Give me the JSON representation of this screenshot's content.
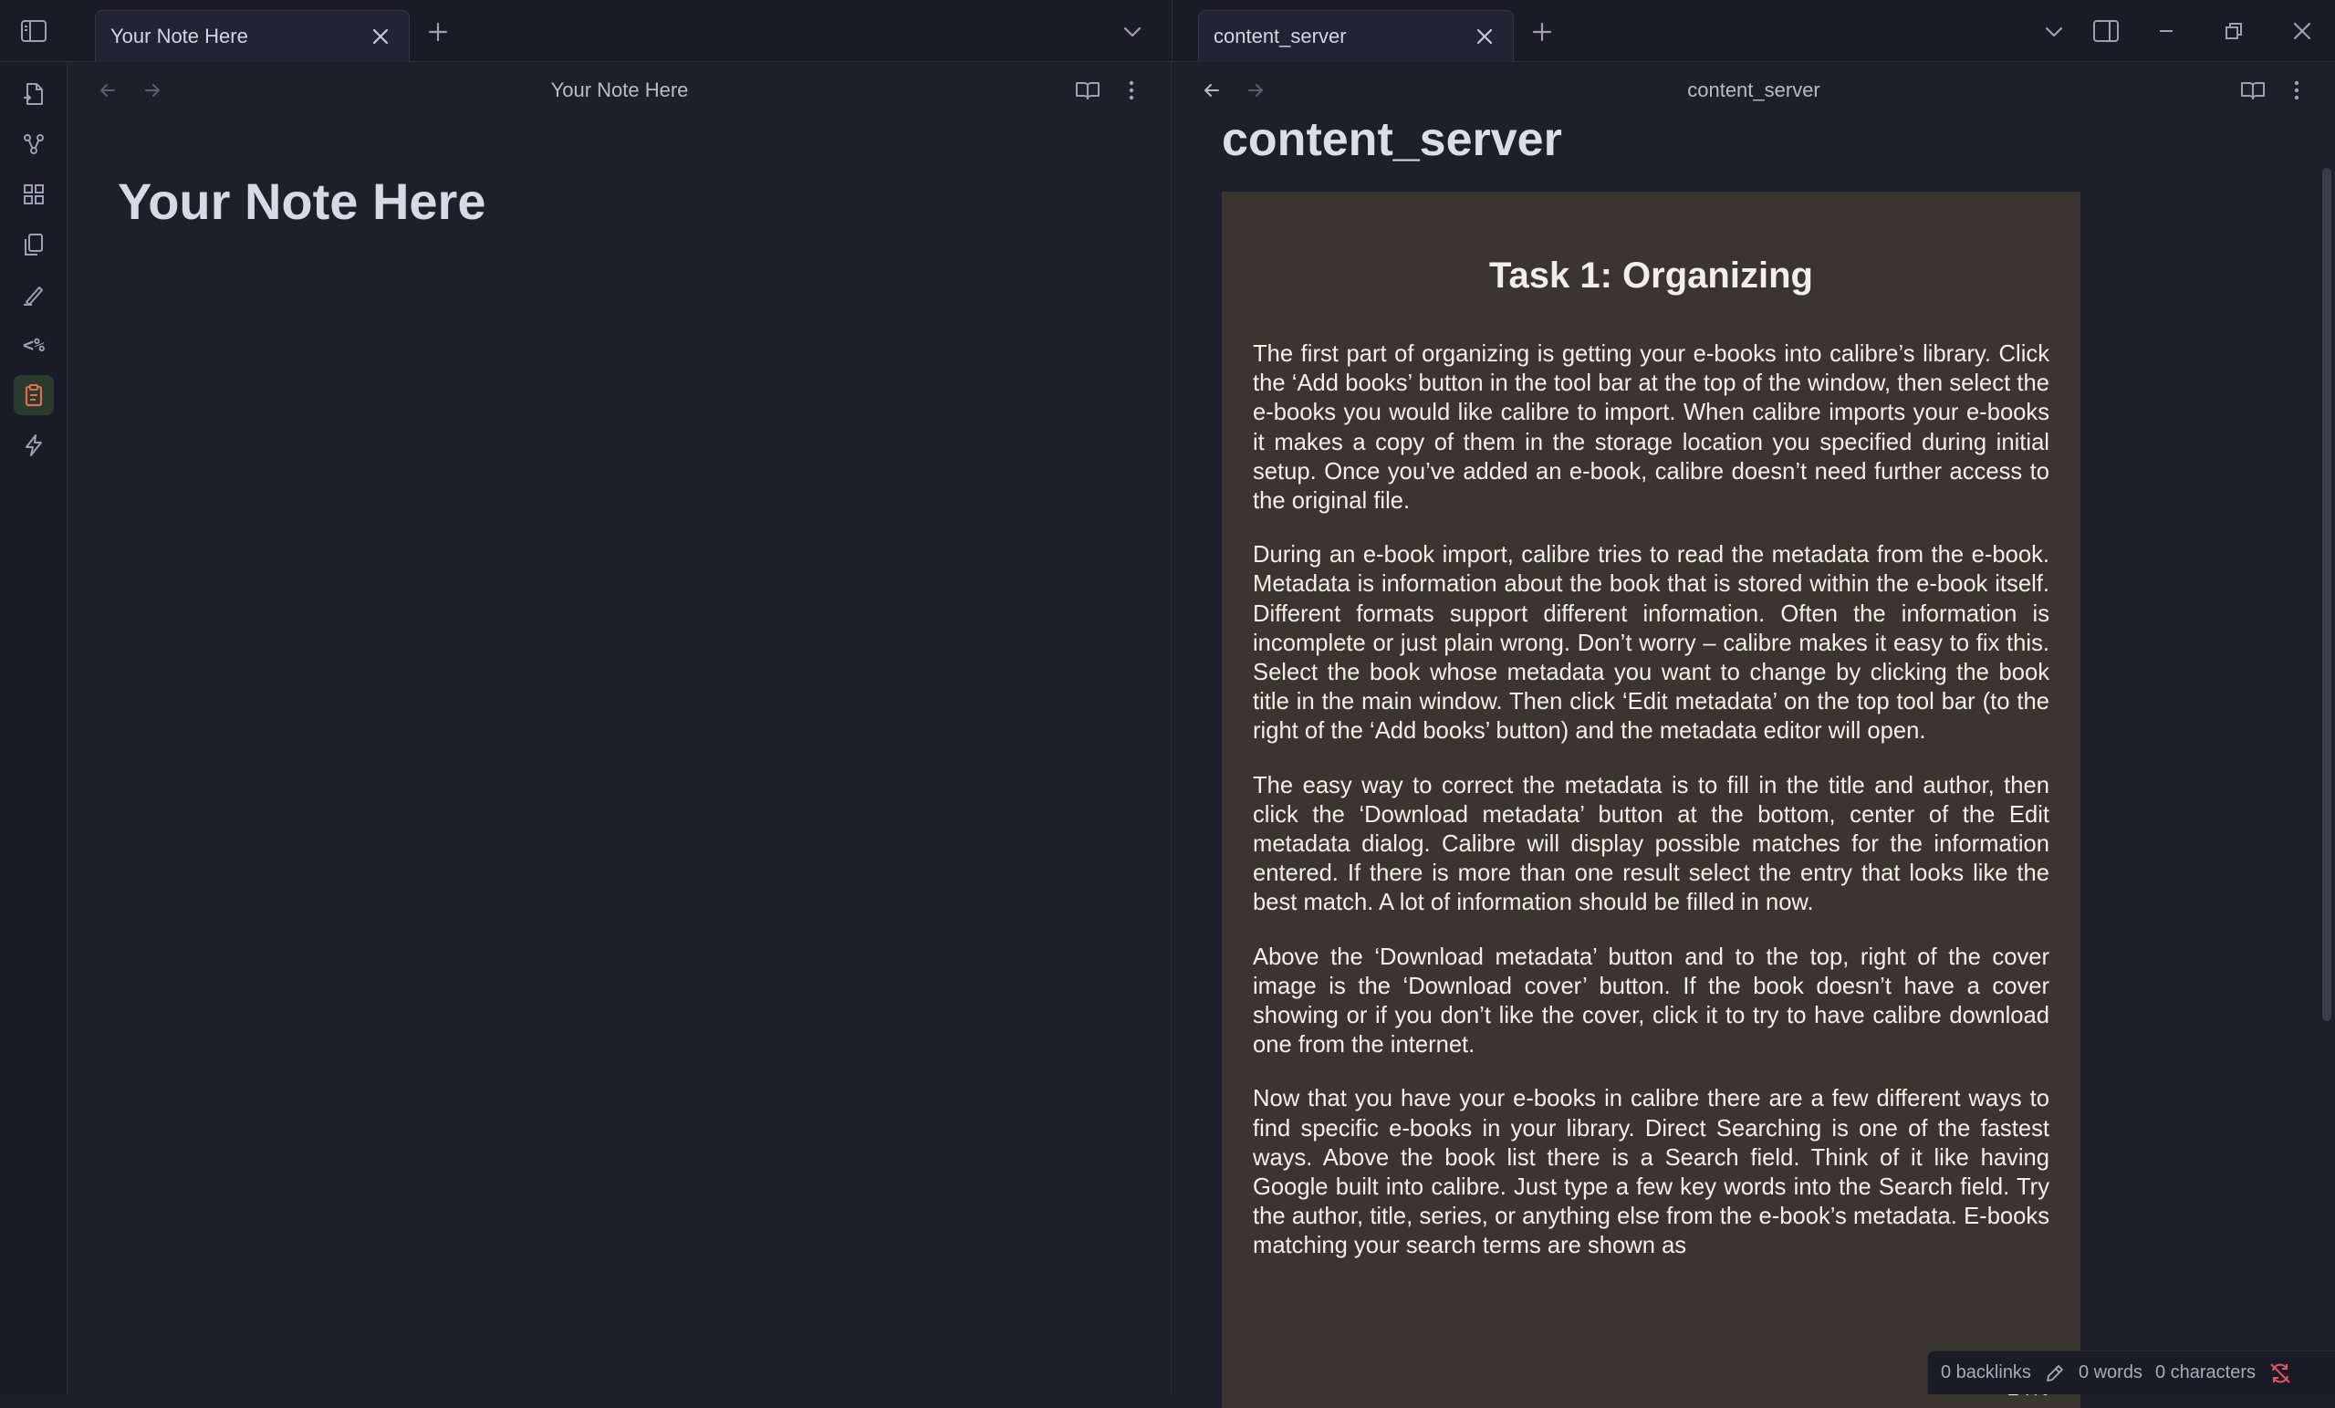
{
  "left_tab": {
    "title": "Your Note Here"
  },
  "right_tab": {
    "title": "content_server"
  },
  "left_view": {
    "header_title": "Your Note Here",
    "note_title": "Your Note Here"
  },
  "right_view": {
    "header_title": "content_server",
    "doc_title": "content_server",
    "pdf": {
      "heading": "Task 1: Organizing",
      "paragraphs": [
        "The first part of organizing is getting your e-books into calibre’s library. Click the ‘Add books’ button in the tool bar at the top of the window, then select the e-books you would like calibre to import. When calibre imports your e-books it makes a copy of them in the storage location you specified during initial setup. Once you’ve added an e-book, calibre doesn’t need further access to the original file.",
        "During an e-book import, calibre tries to read the metadata from the e-book. Metadata is information about the book that is stored within the e-book itself. Different formats support different information. Often the information is incomplete or just plain wrong. Don’t worry – calibre makes it easy to fix this. Select the book whose metadata you want to change by clicking the book title in the main window. Then click ‘Edit metadata’ on the top tool bar (to the right of the ‘Add books’ button) and the metadata editor will open.",
        "The easy way to correct the metadata is to fill in the title and author, then click the ‘Download metadata’ button at the bottom, center of the Edit metadata dialog. Calibre will display possible matches for the information entered. If there is more than one result select the entry that looks like the best match. A lot of information should be filled in now.",
        "Above the ‘Download metadata’ button and to the top, right of the cover image is the ‘Download cover’ button. If the book doesn’t have a cover showing or if you don’t like the cover, click it to try to have calibre download one from the internet.",
        "Now that you have your e-books in calibre there are a few different ways to find specific e-books in your library. Direct Searching is one of the fastest ways. Above the book list there is a Search field. Think of it like having Google built into calibre. Just type a few key words into the Search field. Try the author, title, series, or anything else from the e-book’s metadata. E-books matching your search terms are shown as"
      ],
      "percent": "24%"
    }
  },
  "ribbon": {
    "items": [
      "open-quick-switcher-icon",
      "graph-view-icon",
      "canvas-icon",
      "templates-icon",
      "draw-icon",
      "templater-icon",
      "clipboard-icon",
      "lightning-icon"
    ],
    "active_index": 6
  },
  "status": {
    "backlinks": "0 backlinks",
    "words": "0 words",
    "characters": "0 characters"
  },
  "colors": {
    "background": "#1e1f2b",
    "pdf_page": "#3b3530",
    "accent_active": "#e06c4a",
    "sync_error": "#e05561"
  }
}
